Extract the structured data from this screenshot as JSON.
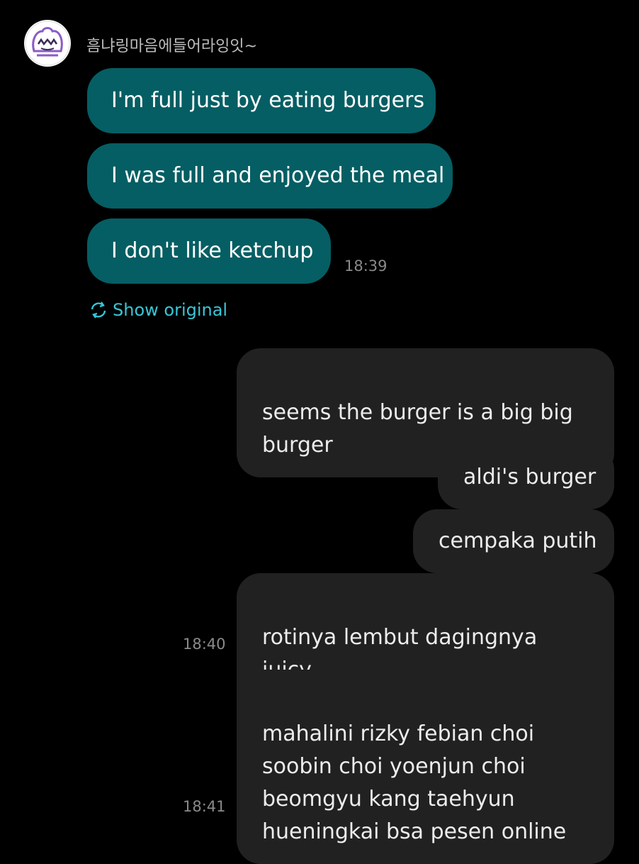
{
  "chat": {
    "sender_name": "흠냐링마음에들어라잉잇~",
    "incoming": [
      {
        "text": "I'm full just by eating burgers"
      },
      {
        "text": "I was full and enjoyed the meal"
      },
      {
        "text": "I don't like ketchup"
      }
    ],
    "incoming_time": "18:39",
    "show_original_label": "Show original",
    "outgoing": [
      {
        "text": "seems the burger is a big big\nburger"
      },
      {
        "text": "aldi's burger"
      },
      {
        "text": "cempaka putih"
      },
      {
        "text": "rotinya lembut dagingnya juicy\nluicy"
      },
      {
        "text": "mahalini rizky febian choi\nsoobin choi yoenjun choi\nbeomgyu kang taehyun\nhueningkai bsa pesen online"
      }
    ],
    "outgoing_times": [
      "18:40",
      "18:41"
    ]
  },
  "colors": {
    "background": "#000000",
    "incoming_bubble": "#055e63",
    "outgoing_bubble": "#212121",
    "accent": "#38c6d6"
  },
  "icons": {
    "avatar": "cartoon-face-avatar",
    "show_original": "translate-refresh-icon"
  }
}
